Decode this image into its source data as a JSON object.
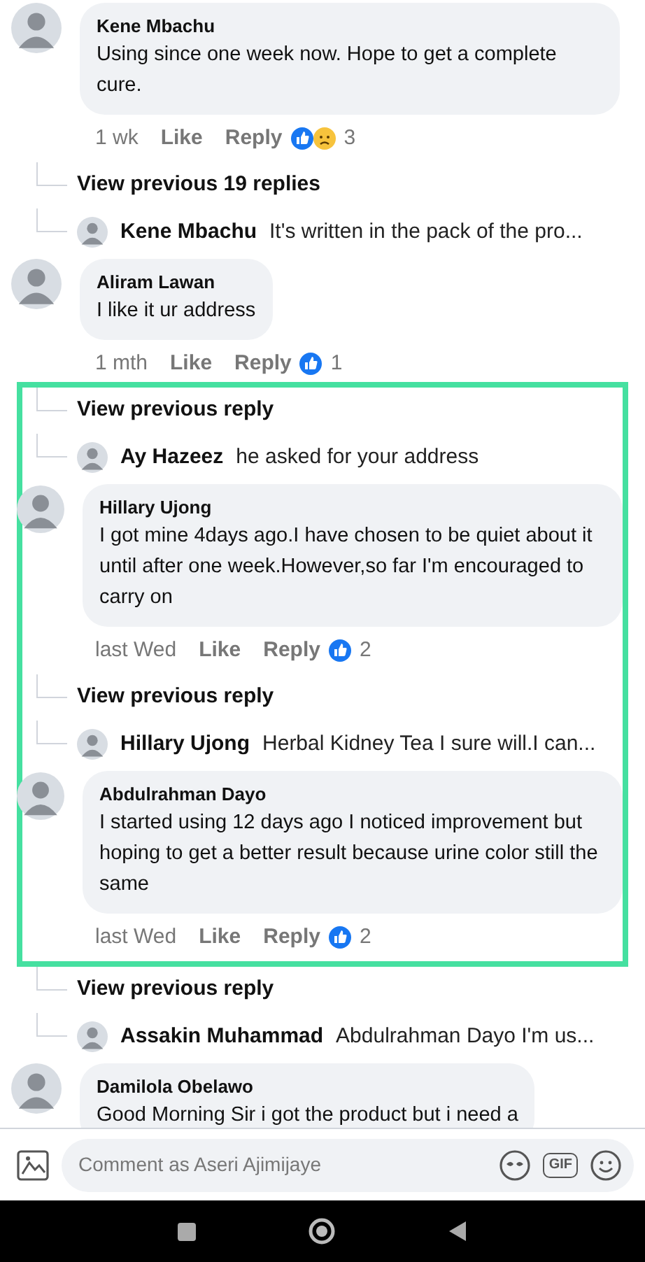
{
  "sections": [
    {
      "highlighted": false,
      "items": [
        {
          "kind": "comment",
          "author": "Kene Mbachu",
          "text": "Using since one week now. Hope to get a complete cure.",
          "time": "1 wk",
          "like": "Like",
          "reply": "Reply",
          "reactions": [
            {
              "kind": "like"
            },
            {
              "kind": "sad"
            }
          ],
          "reaction_count": "3"
        },
        {
          "kind": "view_more",
          "label": "View previous 19 replies"
        },
        {
          "kind": "reply_preview",
          "author": "Kene Mbachu",
          "text": "It's written in the pack of the pro..."
        },
        {
          "kind": "comment",
          "author": "Aliram Lawan",
          "text": "I like it ur address",
          "time": "1 mth",
          "like": "Like",
          "reply": "Reply",
          "reactions": [
            {
              "kind": "like"
            }
          ],
          "reaction_count": "1"
        }
      ]
    },
    {
      "highlighted": true,
      "items": [
        {
          "kind": "view_more",
          "label": "View previous reply"
        },
        {
          "kind": "reply_preview",
          "author": "Ay Hazeez",
          "text": "he asked for your address"
        },
        {
          "kind": "comment",
          "author": "Hillary Ujong",
          "text": "I got mine 4days ago.I have chosen to be quiet about it until after one week.However,so far I'm encouraged to carry on",
          "time": "last Wed",
          "like": "Like",
          "reply": "Reply",
          "reactions": [
            {
              "kind": "like"
            }
          ],
          "reaction_count": "2"
        },
        {
          "kind": "view_more",
          "label": "View previous reply"
        },
        {
          "kind": "reply_preview",
          "author": "Hillary Ujong",
          "text": "Herbal Kidney Tea I sure will.I can..."
        },
        {
          "kind": "comment",
          "author": "Abdulrahman Dayo",
          "text": "I started using 12 days ago I noticed improvement but hoping to get a better result because urine color still the same",
          "time": "last Wed",
          "like": "Like",
          "reply": "Reply",
          "reactions": [
            {
              "kind": "like"
            }
          ],
          "reaction_count": "2"
        }
      ]
    },
    {
      "highlighted": false,
      "items": [
        {
          "kind": "view_more",
          "label": "View previous reply"
        },
        {
          "kind": "reply_preview",
          "author": "Assakin Muhammad",
          "text": "Abdulrahman Dayo I'm us..."
        },
        {
          "kind": "comment",
          "author": "Damilola Obelawo",
          "text": "Good Morning Sir i got the product but i need a"
        }
      ]
    }
  ],
  "composer": {
    "placeholder": "Comment as Aseri Ajimijaye",
    "gif": "GIF"
  }
}
